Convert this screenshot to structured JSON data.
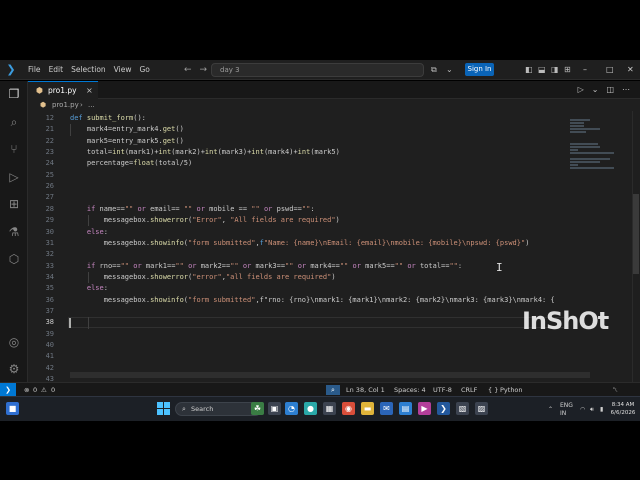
{
  "titlebar": {
    "menu": [
      "File",
      "Edit",
      "Selection",
      "View",
      "Go"
    ],
    "search_text": "day 3",
    "signin_label": "Sign In"
  },
  "tab": {
    "filename": "pro1.py",
    "close_glyph": "×"
  },
  "breadcrumb": {
    "file": "pro1.py",
    "ellipsis": "..."
  },
  "editor": {
    "cursor_line": 38,
    "lines": [
      {
        "n": "12",
        "code": "def submit_form():"
      },
      {
        "n": "21",
        "code": "    mark4=entry_mark4.get()"
      },
      {
        "n": "22",
        "code": "    mark5=entry_mark5.get()"
      },
      {
        "n": "23",
        "code": "    total=int(mark1)+int(mark2)+int(mark3)+int(mark4)+int(mark5)"
      },
      {
        "n": "24",
        "code": "    percentage=float(total/5)"
      },
      {
        "n": "25",
        "code": ""
      },
      {
        "n": "26",
        "code": ""
      },
      {
        "n": "27",
        "code": ""
      },
      {
        "n": "28",
        "code": "    if name==\"\" or email== \"\" or mobile == \"\" or pswd==\"\":"
      },
      {
        "n": "29",
        "code": "        messagebox.showerror(\"Error\", \"All fields are required\")"
      },
      {
        "n": "30",
        "code": "    else:"
      },
      {
        "n": "31",
        "code": "        messagebox.showinfo(\"form submitted\",f\"Name: {name}\\nEmail: {email}\\nmobile: {mobile}\\npswd: {pswd}\")"
      },
      {
        "n": "32",
        "code": ""
      },
      {
        "n": "33",
        "code": "    if rno==\"\" or mark1==\"\" or mark2==\"\" or mark3==\"\" or mark4==\"\" or mark5==\"\" or total==\"\":"
      },
      {
        "n": "34",
        "code": "        messagebox.showerror(\"error\",\"all fields are required\")"
      },
      {
        "n": "35",
        "code": "    else:"
      },
      {
        "n": "36",
        "code": "        messagebox.showinfo(\"form submitted\",f\"rno: {rno}\\nmark1: {mark1}\\nmark2: {mark2}\\nmark3: {mark3}\\nmark4: {"
      },
      {
        "n": "37",
        "code": ""
      },
      {
        "n": "38",
        "code": ""
      },
      {
        "n": "39",
        "code": ""
      },
      {
        "n": "40",
        "code": ""
      },
      {
        "n": "41",
        "code": ""
      },
      {
        "n": "42",
        "code": ""
      },
      {
        "n": "43",
        "code": ""
      }
    ]
  },
  "statusbar": {
    "errors": "0",
    "warnings": "0",
    "position": "Ln 38, Col 1",
    "spaces": "Spaces: 4",
    "encoding": "UTF-8",
    "eol": "CRLF",
    "language": "Python"
  },
  "taskbar": {
    "search_label": "Search",
    "lang_top": "ENG",
    "lang_bottom": "IN",
    "time": "8:34 AM",
    "date": "6/6/2026"
  },
  "watermark": {
    "text": "InShOt"
  },
  "colors": {
    "accent": "#0078d4",
    "editor_bg": "#1f1f1f",
    "signin": "#0a64b7"
  }
}
